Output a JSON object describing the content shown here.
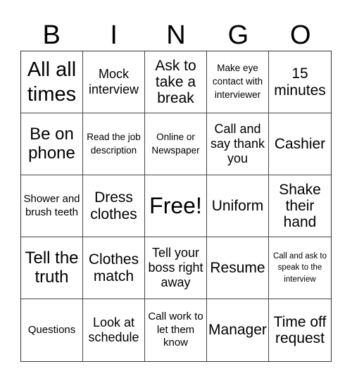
{
  "header": {
    "letters": [
      "B",
      "I",
      "N",
      "G",
      "O"
    ]
  },
  "cells": [
    {
      "text": "All all times",
      "size": "s-xl"
    },
    {
      "text": "Mock interview",
      "size": "s-m"
    },
    {
      "text": "Ask to take a break",
      "size": "s-lm"
    },
    {
      "text": "Make eye contact with interviewer",
      "size": "s-xs"
    },
    {
      "text": "15 minutes",
      "size": "s-lm"
    },
    {
      "text": "Be on phone",
      "size": "s-l"
    },
    {
      "text": "Read the job description",
      "size": "s-xs"
    },
    {
      "text": "Online or Newspaper",
      "size": "s-xs"
    },
    {
      "text": "Call and say thank you",
      "size": "s-m"
    },
    {
      "text": "Cashier",
      "size": "s-lm"
    },
    {
      "text": "Shower and brush teeth",
      "size": "s-s"
    },
    {
      "text": "Dress clothes",
      "size": "s-lm"
    },
    {
      "text": "Free!",
      "size": "s-free"
    },
    {
      "text": "Uniform",
      "size": "s-lm"
    },
    {
      "text": "Shake their hand",
      "size": "s-lm"
    },
    {
      "text": "Tell the truth",
      "size": "s-l"
    },
    {
      "text": "Clothes match",
      "size": "s-lm"
    },
    {
      "text": "Tell your boss right away",
      "size": "s-m"
    },
    {
      "text": "Resume",
      "size": "s-lm"
    },
    {
      "text": "Call and ask to speak to the interview",
      "size": "s-xxs"
    },
    {
      "text": "Questions",
      "size": "s-s"
    },
    {
      "text": "Look at schedule",
      "size": "s-m"
    },
    {
      "text": "Call work to let them know",
      "size": "s-s"
    },
    {
      "text": "Manager",
      "size": "s-lm"
    },
    {
      "text": "Time off request",
      "size": "s-lm"
    }
  ]
}
